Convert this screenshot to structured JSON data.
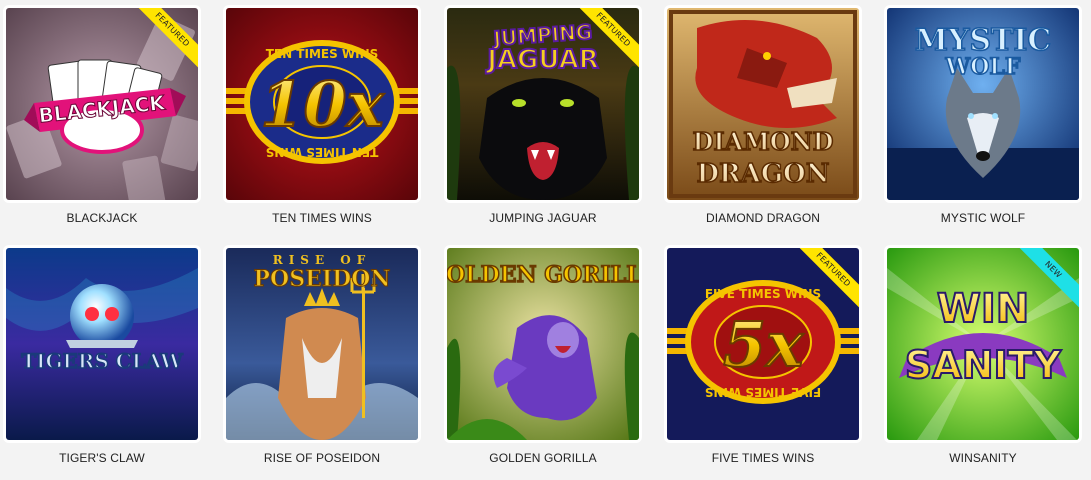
{
  "games": [
    {
      "title": "BLACKJACK",
      "badge": "FEATURED",
      "badge_color": "#ffe400",
      "art_text": "BLACKJACK"
    },
    {
      "title": "TEN TIMES WINS",
      "badge": "",
      "art_text": "10x",
      "art_ring": "TEN TIMES WINS"
    },
    {
      "title": "JUMPING JAGUAR",
      "badge": "FEATURED",
      "badge_color": "#ffe400",
      "art_text_1": "JUMPING",
      "art_text_2": "JAGUAR"
    },
    {
      "title": "DIAMOND DRAGON",
      "badge": "",
      "art_text_1": "DIAMOND",
      "art_text_2": "DRAGON"
    },
    {
      "title": "MYSTIC WOLF",
      "badge": "",
      "art_text_1": "MYSTIC",
      "art_text_2": "WOLF"
    },
    {
      "title": "TIGER'S CLAW",
      "badge": "",
      "art_text": "TIGERS CLAW"
    },
    {
      "title": "RISE OF POSEIDON",
      "badge": "",
      "art_text_1": "RISE OF",
      "art_text_2": "POSEIDON"
    },
    {
      "title": "GOLDEN GORILLA",
      "badge": "",
      "art_text": "GOLDEN GORILLA"
    },
    {
      "title": "FIVE TIMES WINS",
      "badge": "FEATURED",
      "badge_color": "#ffe400",
      "art_text": "5x",
      "art_ring": "FIVE TIMES WINS"
    },
    {
      "title": "WINSANITY",
      "badge": "NEW",
      "badge_color": "#1ee0e6",
      "art_text_1": "WIN",
      "art_text_2": "SANITY"
    }
  ]
}
